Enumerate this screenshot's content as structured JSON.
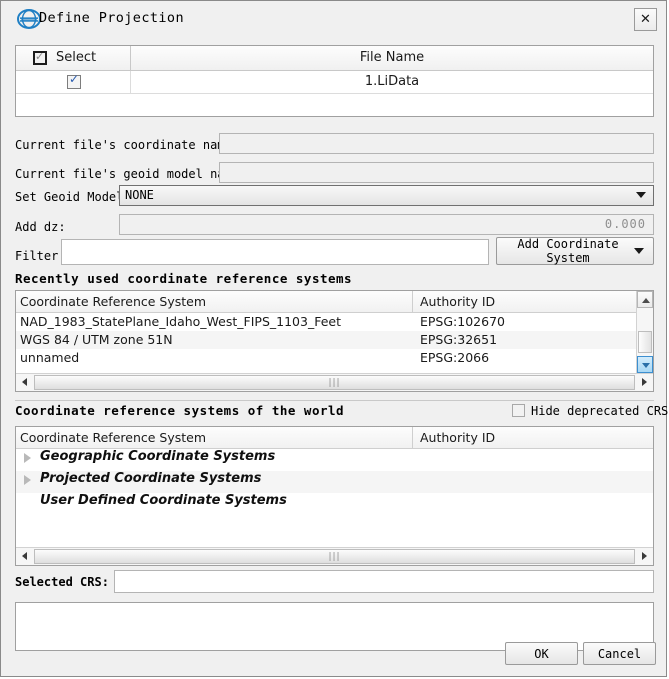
{
  "window": {
    "title": "Define Projection",
    "logo_icon": "lidar360-logo-icon",
    "close_label": "✕"
  },
  "file_table": {
    "columns": {
      "select": "Select",
      "file_name": "File Name"
    },
    "header_checkbox_checked": true,
    "rows": [
      {
        "selected": true,
        "file_name": "1.LiData"
      }
    ]
  },
  "form": {
    "current_coordinate_label": "Current file's coordinate name:",
    "current_coordinate_value": "",
    "current_geoid_label": "Current file's geoid model name:",
    "current_geoid_value": "",
    "set_geoid_label": "Set Geoid Model:",
    "set_geoid_value": "NONE",
    "add_dz_label": "Add dz:",
    "add_dz_value": "0.000",
    "filter_label": "Filter",
    "filter_value": "",
    "add_coordinate_system_button": "Add Coordinate System"
  },
  "recent": {
    "section_title": "Recently used coordinate reference systems",
    "columns": {
      "crs": "Coordinate Reference System",
      "authority": "Authority ID"
    },
    "rows": [
      {
        "crs": "NAD_1983_StatePlane_Idaho_West_FIPS_1103_Feet",
        "authority": "EPSG:102670"
      },
      {
        "crs": "WGS 84 / UTM zone 51N",
        "authority": "EPSG:32651"
      },
      {
        "crs": "unnamed",
        "authority": "EPSG:2066"
      }
    ]
  },
  "world": {
    "section_title": "Coordinate reference systems of the world",
    "hide_deprecated_label": "Hide deprecated CRSs",
    "hide_deprecated_checked": false,
    "columns": {
      "crs": "Coordinate Reference System",
      "authority": "Authority ID"
    },
    "tree": [
      {
        "label": "Geographic Coordinate Systems",
        "expandable": true
      },
      {
        "label": "Projected Coordinate Systems",
        "expandable": true
      },
      {
        "label": "User Defined Coordinate Systems",
        "expandable": false
      }
    ]
  },
  "selected": {
    "label": "Selected CRS:",
    "value": "",
    "details": ""
  },
  "footer": {
    "ok_label": "OK",
    "cancel_label": "Cancel"
  },
  "colors": {
    "dialog_bg": "#f0f0f0",
    "panel_bg": "#ffffff",
    "border": "#a0a0a0",
    "accent_blue": "#2a5db0",
    "scroll_highlight": "#a8d8f5"
  }
}
